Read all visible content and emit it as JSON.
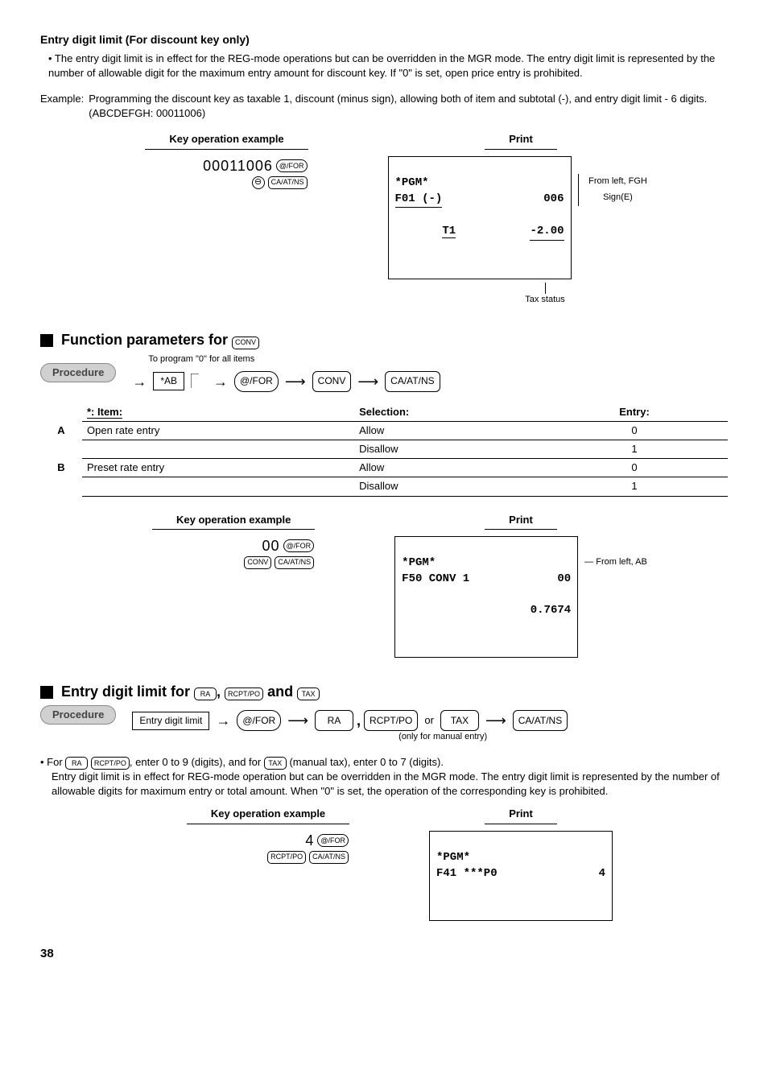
{
  "h1": "Entry digit limit (For discount key only)",
  "bullet1": "• The entry digit limit is in effect for the REG-mode operations but can be overridden in the MGR mode.  The entry digit limit is represented by the number of allowable digit for the maximum entry amount for discount key.  If \"0\" is set, open price entry is prohibited.",
  "example_label": "Example:",
  "example_text": "Programming the discount key as taxable 1, discount (minus sign), allowing both of item and subtotal (-), and entry digit limit - 6 digits.  (ABCDEFGH: 00011006)",
  "kop_header": "Key operation example",
  "print_header": "Print",
  "ex1": {
    "digits": "00011006",
    "keys": [
      "@/FOR",
      "CA/AT/NS"
    ],
    "receipt_l1": "*PGM*",
    "receipt_l2a": "F01 (-)",
    "receipt_l2b": "006",
    "receipt_l3a": "T1",
    "receipt_l3b": "-2.00",
    "callout1": "From left, FGH",
    "callout2": "Sign(E)",
    "sub1": "Tax status"
  },
  "sec2_title": "Function parameters for ",
  "sec2_key": "CONV",
  "procedure": "Procedure",
  "to_program": "To program \"0\" for all items",
  "flow1": {
    "box": "*AB",
    "k1": "@/FOR",
    "k2": "CONV",
    "k3": "CA/AT/NS"
  },
  "table": {
    "star_item": "*: Item:",
    "sel": "Selection:",
    "entry": "Entry:",
    "rows": [
      {
        "item": "A",
        "label": "Open rate entry",
        "sel": "Allow",
        "entry": "0"
      },
      {
        "item": "",
        "label": "",
        "sel": "Disallow",
        "entry": "1"
      },
      {
        "item": "B",
        "label": "Preset rate entry",
        "sel": "Allow",
        "entry": "0"
      },
      {
        "item": "",
        "label": "",
        "sel": "Disallow",
        "entry": "1"
      }
    ]
  },
  "ex2": {
    "digits": "00",
    "keys": [
      "@/FOR",
      "CONV",
      "CA/AT/NS"
    ],
    "receipt_l1": "*PGM*",
    "receipt_l2a": "F50 CONV 1",
    "receipt_l2b": "00",
    "receipt_l3b": "0.7674",
    "callout": "From left, AB"
  },
  "sec3_title_a": "Entry digit limit for ",
  "sec3_title_b": " and ",
  "sec3_k1": "RA",
  "sec3_comma": ",",
  "sec3_k2": "RCPT/PO",
  "sec3_k3": "TAX",
  "flow2": {
    "box": "Entry digit limit",
    "k1": "@/FOR",
    "k2": "RA",
    "comma": ",",
    "k3": "RCPT/PO",
    "or": " or ",
    "k4": "TAX",
    "k5": "CA/AT/NS",
    "note": "(only for manual entry)"
  },
  "para2a": "• For ",
  "para2b": ", enter 0 to 9 (digits), and for ",
  "para2c": " (manual tax), enter 0 to 7 (digits).",
  "para2_keys": [
    "RA",
    "RCPT/PO",
    "TAX"
  ],
  "para3": "Entry digit limit is in effect for REG-mode operation but can be overridden in the MGR mode.  The entry digit limit is represented by the number of allowable digits for maximum entry or total amount.  When \"0\" is set, the operation of the corresponding key is prohibited.",
  "ex3": {
    "digits": "4",
    "keys": [
      "@/FOR",
      "RCPT/PO",
      "CA/AT/NS"
    ],
    "receipt_l1": "*PGM*",
    "receipt_l2a": "F41 ***P0",
    "receipt_l2b": "4"
  },
  "page": "38"
}
